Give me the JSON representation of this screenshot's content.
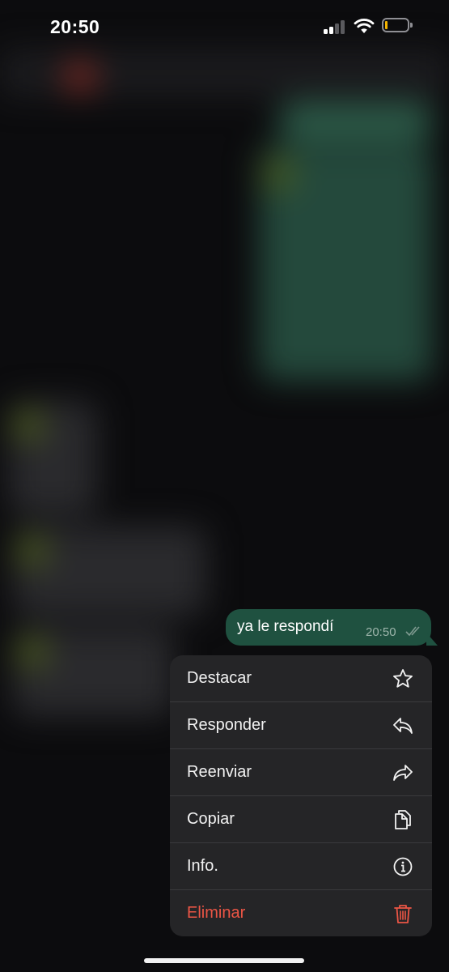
{
  "status_bar": {
    "time": "20:50",
    "battery_level_fraction": 0.1,
    "signal_bars_active": 2,
    "signal_bars_total": 4
  },
  "message": {
    "text": "ya le respondí",
    "time": "20:50",
    "status_icon": "double-check-icon"
  },
  "context_menu": {
    "items": [
      {
        "label": "Destacar",
        "icon": "star-icon"
      },
      {
        "label": "Responder",
        "icon": "reply-icon"
      },
      {
        "label": "Reenviar",
        "icon": "forward-icon"
      },
      {
        "label": "Copiar",
        "icon": "copy-icon"
      },
      {
        "label": "Info.",
        "icon": "info-icon"
      },
      {
        "label": "Eliminar",
        "icon": "trash-icon"
      }
    ]
  },
  "colors": {
    "bubble": "#1f5140",
    "menu_background": "#252527",
    "danger": "#eb5545",
    "battery_fill": "#f5b400"
  }
}
